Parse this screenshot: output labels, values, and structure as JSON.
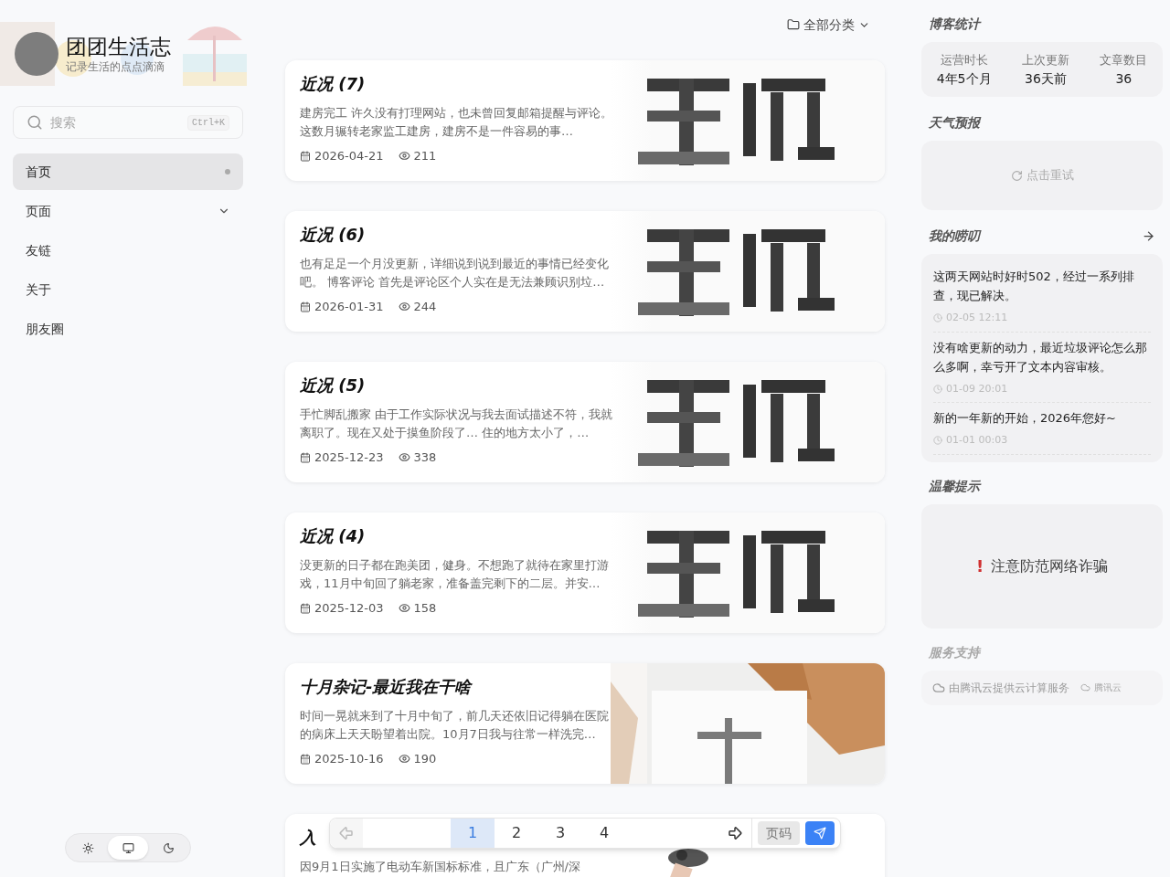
{
  "site": {
    "title": "团团生活志",
    "subtitle": "记录生活的点点滴滴"
  },
  "search": {
    "placeholder": "搜索",
    "shortcut": "Ctrl+K"
  },
  "nav": [
    {
      "label": "首页",
      "selected": true,
      "kind": "dot"
    },
    {
      "label": "页面",
      "selected": false,
      "kind": "dropdown"
    },
    {
      "label": "友链",
      "selected": false,
      "kind": "plain"
    },
    {
      "label": "关于",
      "selected": false,
      "kind": "plain"
    },
    {
      "label": "朋友圈",
      "selected": false,
      "kind": "plain"
    }
  ],
  "theme_switch": [
    {
      "kind": "light",
      "selected": false
    },
    {
      "kind": "system",
      "selected": true
    },
    {
      "kind": "dark",
      "selected": false
    }
  ],
  "category_filter": "全部分类",
  "posts": [
    {
      "title": "近况 (7)",
      "excerpt": "建房完工 许久没有打理网站，也未曾回复邮箱提醒与评论。这数月辗转老家监工建房，建房不是一件容易的事…",
      "date": "2026-04-21",
      "views": "211"
    },
    {
      "title": "近况 (6)",
      "excerpt": "也有足足一个月没更新，详细说到说到最近的事情已经变化吧。 博客评论 首先是评论区个人实在是无法兼顾识别垃…",
      "date": "2026-01-31",
      "views": "244"
    },
    {
      "title": "近况 (5)",
      "excerpt": "手忙脚乱搬家 由于工作实际状况与我去面试描述不符，我就离职了。现在又处于摸鱼阶段了… 住的地方太小了，…",
      "date": "2025-12-23",
      "views": "338"
    },
    {
      "title": "近况 (4)",
      "excerpt": "没更新的日子都在跑美团，健身。不想跑了就待在家里打游戏，11月中旬回了躺老家，准备盖完剩下的二层。并安…",
      "date": "2025-12-03",
      "views": "158"
    },
    {
      "title": "十月杂记-最近我在干啥",
      "excerpt": "时间一晃就来到了十月中旬了，前几天还依旧记得躺在医院的病床上天天盼望着出院。10月7日我与往常一样洗完…",
      "date": "2025-10-16",
      "views": "190"
    },
    {
      "title": "入",
      "excerpt": "因9月1日实施了电动车新国标标准，且广东（广州/深"
    }
  ],
  "pagination": {
    "pages": [
      {
        "label": "1",
        "selected": true
      },
      {
        "label": "2",
        "selected": false
      },
      {
        "label": "3",
        "selected": false
      },
      {
        "label": "4",
        "selected": false
      }
    ],
    "prev_disabled": true,
    "page_input_placeholder": "页码"
  },
  "stats": {
    "title": "博客统计",
    "items": [
      {
        "label": "运营时长",
        "value": "4年5个月"
      },
      {
        "label": "上次更新",
        "value": "36天前"
      },
      {
        "label": "文章数目",
        "value": "36"
      }
    ]
  },
  "weather": {
    "title": "天气预报",
    "retry": "点击重试"
  },
  "murmurs": {
    "title": "我的唠叨",
    "items": [
      {
        "text": "这两天网站时好时502，经过一系列排查，现已解决。",
        "time": "02-05 12:11"
      },
      {
        "text": "没有啥更新的动力，最近垃圾评论怎么那么多啊，幸亏开了文本内容审核。",
        "time": "01-09 20:01"
      },
      {
        "text": "新的一年新的开始，2026年您好~",
        "time": "01-01 00:03"
      }
    ]
  },
  "notice": {
    "title": "温馨提示",
    "mark": "!",
    "text": "注意防范网络诈骗"
  },
  "service": {
    "title": "服务支持",
    "text": "由腾讯云提供云计算服务",
    "brand": "腾讯云"
  }
}
